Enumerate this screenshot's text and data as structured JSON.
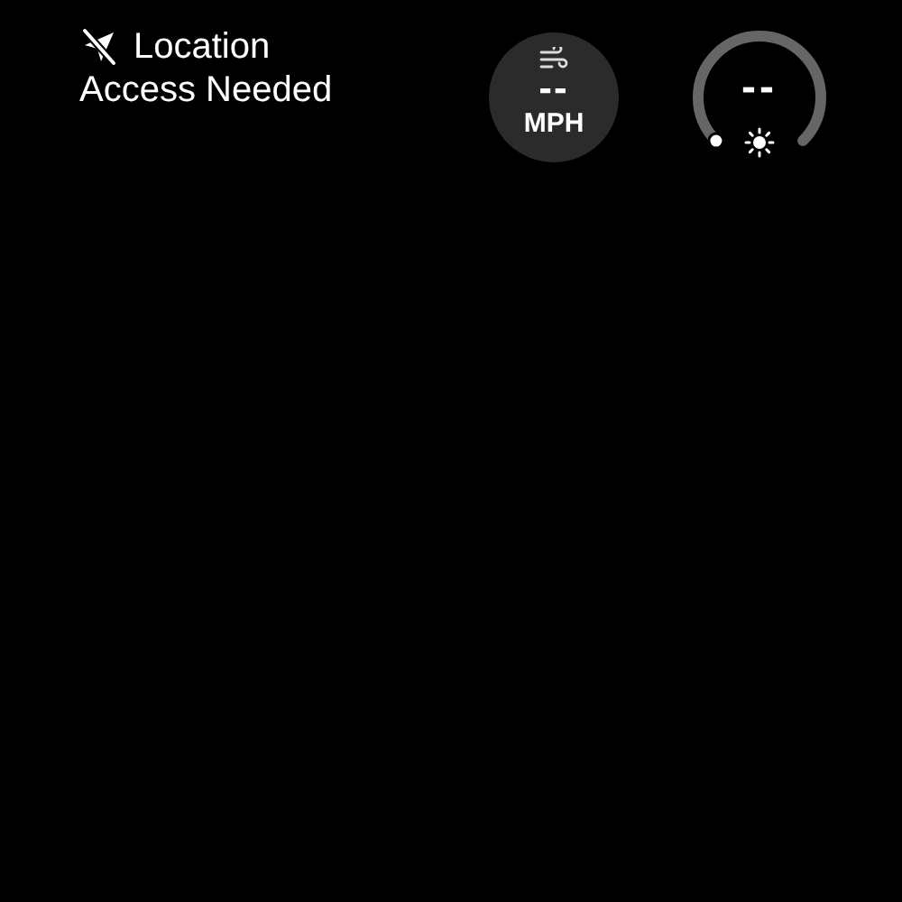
{
  "location_notice": {
    "lines": [
      "Location",
      "Access Needed"
    ]
  },
  "wind": {
    "value": "--",
    "unit": "MPH"
  },
  "uv_gauge": {
    "value": "--"
  }
}
